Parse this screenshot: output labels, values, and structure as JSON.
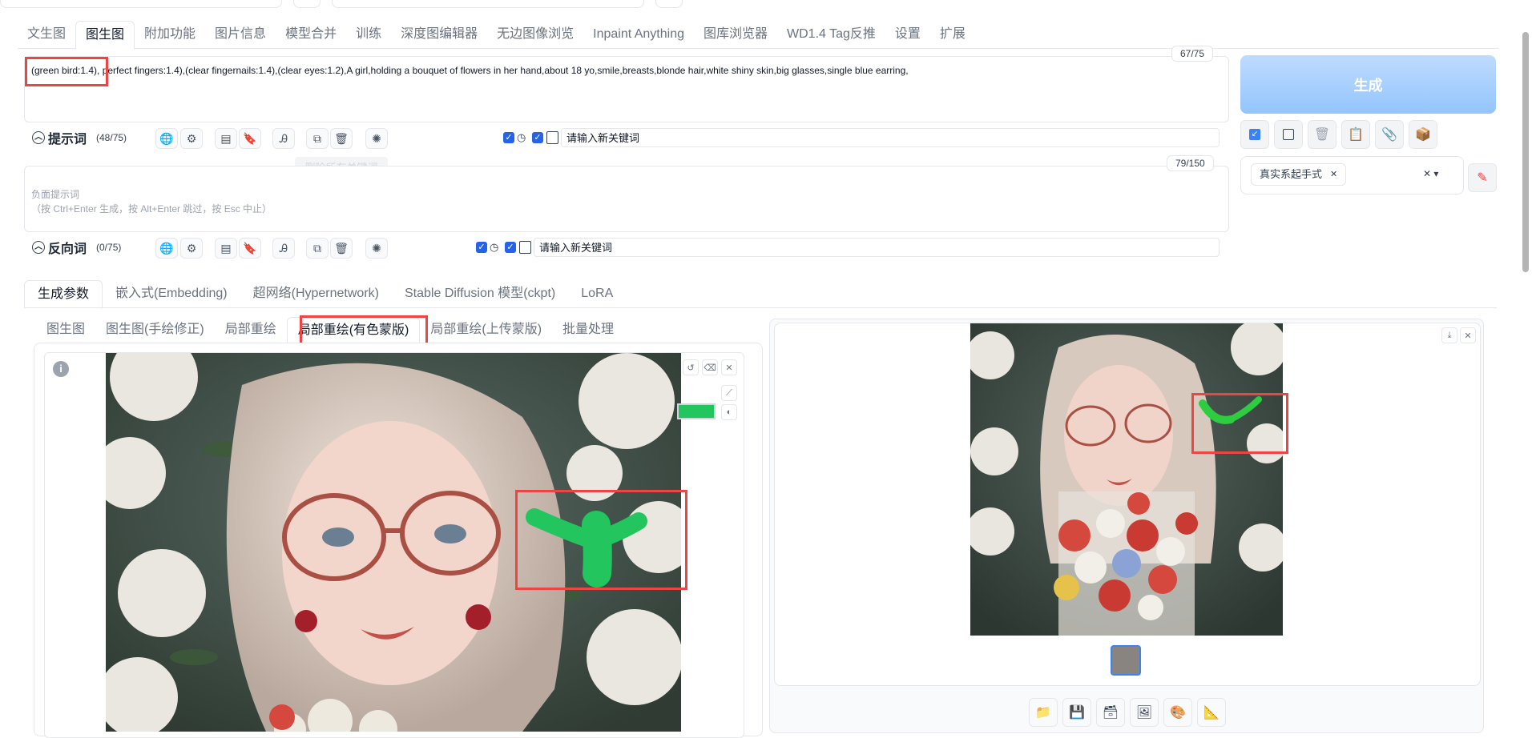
{
  "main_tabs": [
    "文生图",
    "图生图",
    "附加功能",
    "图片信息",
    "模型合并",
    "训练",
    "深度图编辑器",
    "无边图像浏览",
    "Inpaint Anything",
    "图库浏览器",
    "WD1.4 Tag反推",
    "设置",
    "扩展"
  ],
  "prompt": {
    "text": "(green bird:1.4), perfect fingers:1.4),(clear fingernails:1.4),(clear eyes:1.2),A girl,holding a bouquet of flowers in her hand,about 18 yo,smile,breasts,blonde hair,white shiny skin,big glasses,single blue earring,",
    "counter": "67/75",
    "label": "提示词",
    "label_count": "(48/75)",
    "tooltip": "删除所有关键词",
    "keyword_placeholder": "请输入新关键词"
  },
  "negative": {
    "placeholder": "负面提示词\n（按 Ctrl+Enter 生成，按 Alt+Enter 跳过，按 Esc 中止）",
    "counter": "79/150",
    "label": "反向词",
    "label_count": "(0/75)",
    "keyword_placeholder": "请输入新关键词"
  },
  "generate_label": "生成",
  "style_tag": "真实系起手式",
  "param_tabs": [
    "生成参数",
    "嵌入式(Embedding)",
    "超网络(Hypernetwork)",
    "Stable Diffusion 模型(ckpt)",
    "LoRA"
  ],
  "img2img_tabs": [
    "图生图",
    "图生图(手绘修正)",
    "局部重绘",
    "局部重绘(有色蒙版)",
    "局部重绘(上传蒙版)",
    "批量处理"
  ],
  "colors": {
    "accent": "#2563eb",
    "mask": "#22c55e",
    "highlight": "#ef4444",
    "generate_from": "#bfdbfe",
    "generate_to": "#93c5fd"
  }
}
